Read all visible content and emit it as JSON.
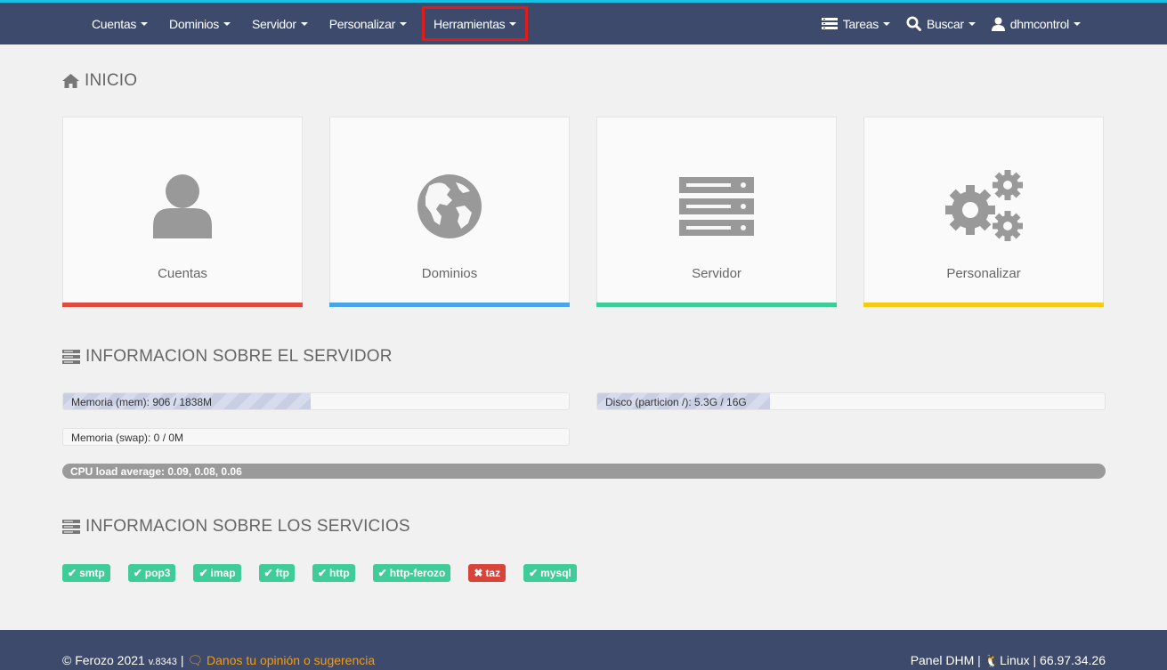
{
  "nav": {
    "left": [
      {
        "label": "Cuentas"
      },
      {
        "label": "Dominios"
      },
      {
        "label": "Servidor"
      },
      {
        "label": "Personalizar"
      },
      {
        "label": "Herramientas"
      }
    ],
    "tasks_label": "Tareas",
    "search_label": "Buscar",
    "user_label": "dhmcontrol",
    "highlight_color": "#e01b1b"
  },
  "home": {
    "title": "INICIO",
    "tiles": [
      {
        "label": "Cuentas",
        "icon": "user-icon",
        "color": "#e04b3f"
      },
      {
        "label": "Dominios",
        "icon": "globe-icon",
        "color": "#4ba3e8"
      },
      {
        "label": "Servidor",
        "icon": "server-icon",
        "color": "#3fcc99"
      },
      {
        "label": "Personalizar",
        "icon": "gears-icon",
        "color": "#f5cc12"
      }
    ]
  },
  "server_info": {
    "title": "INFORMACION SOBRE EL SERVIDOR",
    "memory": {
      "label": "Memoria (mem): 906 / 1838M",
      "fraction": 0.49
    },
    "disk": {
      "label": "Disco (particion /): 5.3G / 16G",
      "fraction": 0.34
    },
    "swap": {
      "label": "Memoria (swap): 0 / 0M",
      "fraction": 0
    },
    "cpu": {
      "label": "CPU load average: 0.09, 0.08, 0.06"
    }
  },
  "services_info": {
    "title": "INFORMACION SOBRE LOS SERVICIOS",
    "items": [
      {
        "name": "smtp",
        "status": "ok"
      },
      {
        "name": "pop3",
        "status": "ok"
      },
      {
        "name": "imap",
        "status": "ok"
      },
      {
        "name": "ftp",
        "status": "ok"
      },
      {
        "name": "http",
        "status": "ok"
      },
      {
        "name": "http-ferozo",
        "status": "ok"
      },
      {
        "name": "taz",
        "status": "error"
      },
      {
        "name": "mysql",
        "status": "ok"
      }
    ],
    "ok_color": "#3fcc99",
    "error_color": "#d9443a"
  },
  "footer": {
    "copyright": "© Ferozo 2021",
    "version": "v.8343",
    "feedback_link": "Danos tu opinión o sugerencia",
    "panel": "Panel DHM",
    "os": "Linux",
    "ip": "66.97.34.26"
  }
}
